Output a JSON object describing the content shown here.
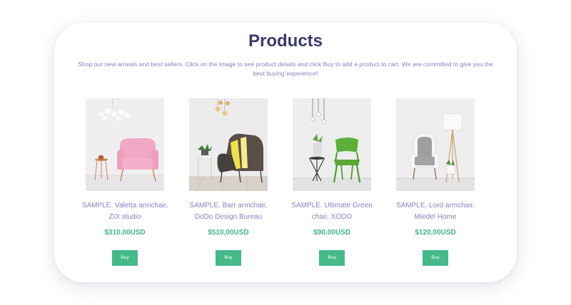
{
  "header": {
    "title": "Products",
    "subtitle": "Shop our new arrivals and best sellers. Click on the image to see product details and click Buy to add a product to cart. We are committed to give you the best buying experience!"
  },
  "products": [
    {
      "name": "SAMPLE. Valetta armchair, ZIX studio",
      "price": "$310,00USD",
      "buy_label": "Buy",
      "image": "pink-armchair"
    },
    {
      "name": "SAMPLE. Barr armchair, DoDo Design Bureau",
      "price": "$510,00USD",
      "buy_label": "Buy",
      "image": "striped-armchair"
    },
    {
      "name": "SAMPLE. Ultimate Green chair, XODO",
      "price": "$90,00USD",
      "buy_label": "Buy",
      "image": "green-chair"
    },
    {
      "name": "SAMPLE. Lord armchair, Miedel Home",
      "price": "$120,00USD",
      "buy_label": "Buy",
      "image": "white-armchair"
    }
  ],
  "colors": {
    "title": "#3a3a6a",
    "text": "#8a7fc0",
    "price": "#3fb583",
    "button": "#45b98a"
  }
}
